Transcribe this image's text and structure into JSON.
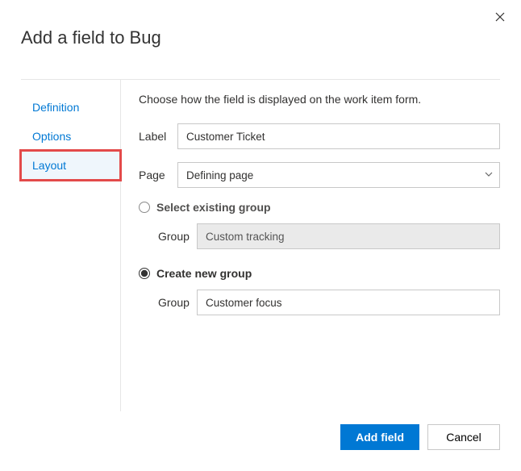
{
  "dialog": {
    "title": "Add a field to Bug"
  },
  "tabs": {
    "items": [
      {
        "label": "Definition"
      },
      {
        "label": "Options"
      },
      {
        "label": "Layout"
      }
    ]
  },
  "pane": {
    "intro": "Choose how the field is displayed on the work item form.",
    "label_field": {
      "label": "Label",
      "value": "Customer Ticket"
    },
    "page_field": {
      "label": "Page",
      "value": "Defining page"
    },
    "existing": {
      "radio_label": "Select existing group",
      "group_label": "Group",
      "group_value": "Custom tracking"
    },
    "create": {
      "radio_label": "Create new group",
      "group_label": "Group",
      "group_value": "Customer focus"
    }
  },
  "footer": {
    "primary": "Add field",
    "cancel": "Cancel"
  }
}
